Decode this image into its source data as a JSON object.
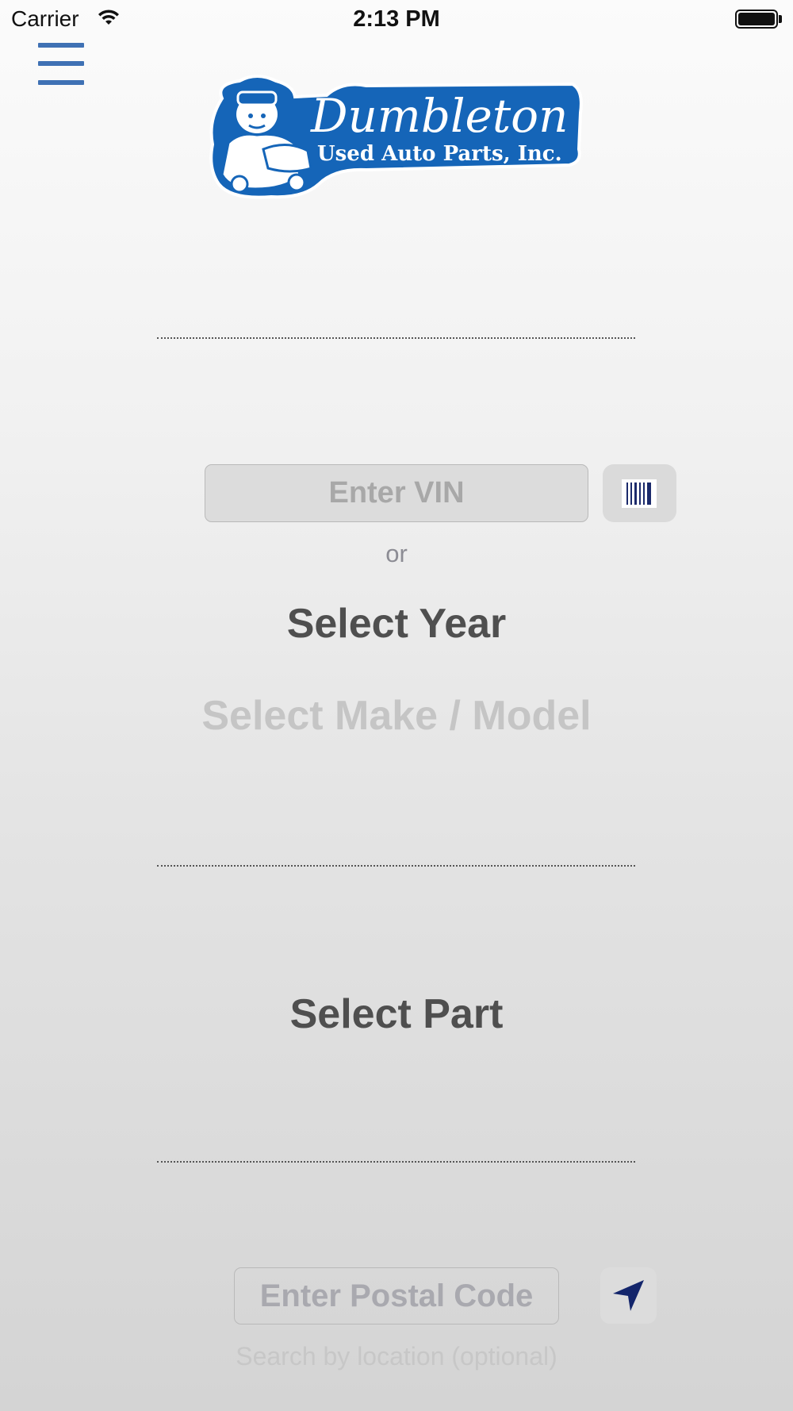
{
  "status_bar": {
    "carrier": "Carrier",
    "time": "2:13 PM",
    "wifi_icon": "wifi-icon",
    "battery_icon": "battery-icon"
  },
  "header": {
    "menu_icon": "hamburger-menu-icon",
    "logo": {
      "brand_name": "Dumbleton",
      "tagline": "Used Auto Parts, Inc.",
      "brand_color": "#1565b8"
    }
  },
  "vehicle": {
    "vin_placeholder": "Enter VIN",
    "barcode_icon": "barcode-scan-icon",
    "or_label": "or",
    "select_year_label": "Select Year",
    "select_make_model_label": "Select Make / Model"
  },
  "part": {
    "select_part_label": "Select Part"
  },
  "location": {
    "postal_placeholder": "Enter Postal Code",
    "location_icon": "location-arrow-icon",
    "hint": "Search by location (optional)"
  },
  "colors": {
    "accent": "#3f71b4",
    "dark_text": "#4f4f4f",
    "disabled_text": "#c5c5c5",
    "location_arrow": "#13256b"
  }
}
